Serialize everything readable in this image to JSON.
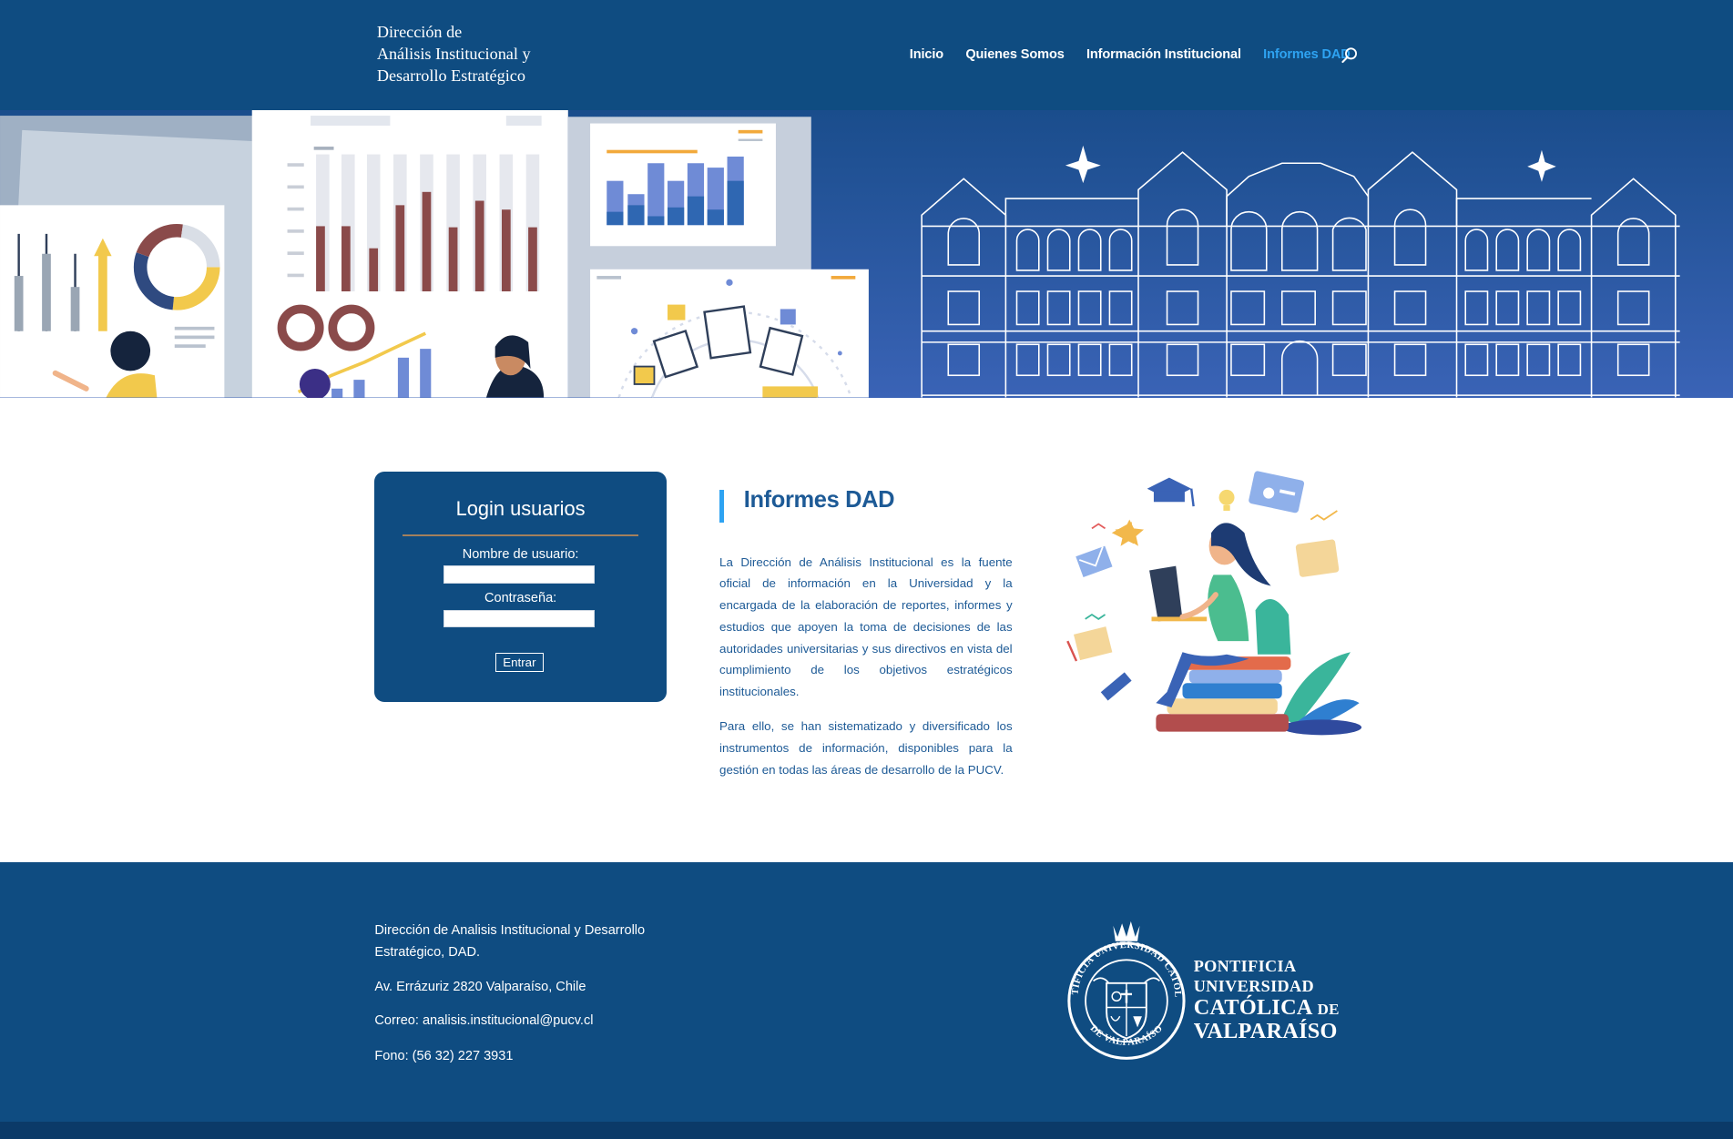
{
  "header": {
    "logo_lines": [
      "Dirección de",
      "Análisis Institucional y",
      "Desarrollo Estratégico"
    ],
    "nav": [
      "Inicio",
      "Quienes Somos",
      "Información Institucional",
      "Informes DAD"
    ],
    "active_nav": "Informes DAD",
    "search_icon": "search-icon"
  },
  "login": {
    "title": "Login usuarios",
    "username_label": "Nombre de usuario:",
    "username_value": "",
    "password_label": "Contraseña:",
    "password_value": "",
    "submit_label": "Entrar"
  },
  "article": {
    "title": "Informes DAD",
    "paragraphs": [
      "La Dirección de Análisis Institucional es la fuente oficial de información en la Universidad y la encargada de la elaboración de reportes, informes y estudios que apoyen la toma de decisiones de las autoridades universitarias y sus directivos en vista del cumplimiento de los objetivos estratégicos institucionales.",
      "Para ello, se han sistematizado y diversificado los instrumentos de información, disponibles para la gestión en todas las áreas de desarrollo de la PUCV."
    ]
  },
  "footer": {
    "org_name": "Dirección de Analisis Institucional y Desarrollo Estratégico, DAD.",
    "org_line1": "Dirección de Analisis Institucional y Desarrollo",
    "org_line2": "Estratégico, DAD.",
    "address": "Av. Errázuriz 2820 Valparaíso, Chile",
    "email": "Correo: analisis.institucional@pucv.cl",
    "phone": "Fono: (56 32) 227 3931",
    "university_lines": [
      "PONTIFICIA",
      "UNIVERSIDAD",
      "CATÓLICA",
      "DE",
      "VALPARAÍSO"
    ],
    "seal_text_top": "PONTIFICIA UNIVERSIDAD CATÓLICA",
    "seal_text_bottom": "DE VALPARAÍSO"
  },
  "colors": {
    "primary": "#0f4c81",
    "accent": "#2ea3f2",
    "article_text": "#1d5a96"
  }
}
